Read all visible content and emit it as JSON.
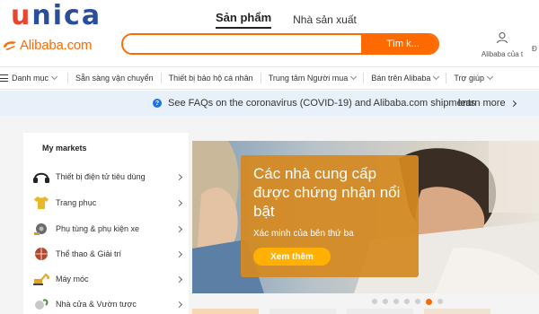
{
  "watermark": {
    "letters": [
      "u",
      "n",
      "i",
      "c",
      "a"
    ],
    "colors": [
      "#e8462b",
      "#2a4e9a",
      "#2a4e9a",
      "#2a4e9a",
      "#2a4e9a"
    ]
  },
  "header": {
    "logo_text": "Alibaba.com",
    "tabs": [
      {
        "label": "Sản phẩm",
        "active": true
      },
      {
        "label": "Nhà sản xuất",
        "active": false
      }
    ],
    "search": {
      "value": "",
      "placeholder": "",
      "button_label": "Tìm k..."
    },
    "account_label": "Alibaba của t",
    "account_label_2": "Đ"
  },
  "nav": {
    "categories_label": "Danh mục",
    "items": [
      {
        "label": "Sẵn sàng vận chuyển",
        "dropdown": false
      },
      {
        "label": "Thiết bị bảo hộ cá nhân",
        "dropdown": false
      },
      {
        "label": "Trung tâm Người mua",
        "dropdown": true
      },
      {
        "label": "Bán trên Alibaba",
        "dropdown": true
      },
      {
        "label": "Trợ giúp",
        "dropdown": true
      }
    ]
  },
  "notice": {
    "message": "See FAQs on the coronavirus (COVID-19) and Alibaba.com shipments",
    "link_label": "learn more"
  },
  "markets": {
    "title": "My markets",
    "items": [
      {
        "label": "Thiết bị điện tử tiêu dùng",
        "icon": "headset-icon"
      },
      {
        "label": "Trang phục",
        "icon": "shirt-icon"
      },
      {
        "label": "Phụ tùng & phụ kiện xe",
        "icon": "car-parts-icon"
      },
      {
        "label": "Thể thao & Giải trí",
        "icon": "ball-icon"
      },
      {
        "label": "Máy móc",
        "icon": "excavator-icon"
      },
      {
        "label": "Nhà cửa & Vườn tược",
        "icon": "home-garden-icon"
      }
    ]
  },
  "hero": {
    "title": "Các nhà cung cấp được chứng nhận nổi bật",
    "subtitle": "Xác minh của bên thứ ba",
    "button_label": "Xem thêm",
    "slide_count": 7,
    "active_slide": 6
  },
  "colors": {
    "brand": "#ff6a00",
    "notice_bg": "#e8f0f9",
    "hero_card": "#d58920",
    "hero_button": "#ffb000"
  }
}
